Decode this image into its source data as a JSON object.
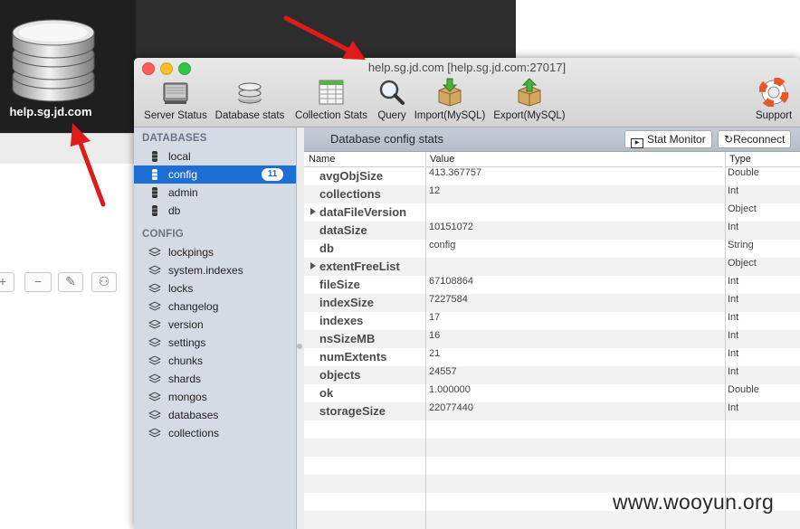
{
  "background_window": {
    "host_label": "help.sg.jd.com",
    "buttons": [
      "+",
      "−",
      "✎",
      "⚇"
    ]
  },
  "window": {
    "title": "help.sg.jd.com [help.sg.jd.com:27017]"
  },
  "toolbar": {
    "server_status": "Server Status",
    "database_stats": "Database stats",
    "collection_stats": "Collection Stats",
    "query": "Query",
    "import": "Import(MySQL)",
    "export": "Export(MySQL)",
    "support": "Support"
  },
  "sidebar": {
    "databases_header": "DATABASES",
    "databases": [
      {
        "label": "local"
      },
      {
        "label": "config",
        "badge": "11",
        "selected": true
      },
      {
        "label": "admin"
      },
      {
        "label": "db"
      }
    ],
    "config_header": "CONFIG",
    "collections": [
      {
        "label": "lockpings"
      },
      {
        "label": "system.indexes"
      },
      {
        "label": "locks"
      },
      {
        "label": "changelog"
      },
      {
        "label": "version"
      },
      {
        "label": "settings"
      },
      {
        "label": "chunks"
      },
      {
        "label": "shards"
      },
      {
        "label": "mongos"
      },
      {
        "label": "databases"
      },
      {
        "label": "collections"
      }
    ]
  },
  "content": {
    "title": "Database config stats",
    "stat_monitor": "Stat Monitor",
    "reconnect": "Reconnect",
    "columns": {
      "name": "Name",
      "value": "Value",
      "type": "Type"
    },
    "rows": [
      {
        "name": "avgObjSize",
        "value": "413.367757",
        "type": "Double"
      },
      {
        "name": "collections",
        "value": "12",
        "type": "Int"
      },
      {
        "name": "dataFileVersion",
        "value": "",
        "type": "Object",
        "expandable": true
      },
      {
        "name": "dataSize",
        "value": "10151072",
        "type": "Int"
      },
      {
        "name": "db",
        "value": "config",
        "type": "String"
      },
      {
        "name": "extentFreeList",
        "value": "",
        "type": "Object",
        "expandable": true
      },
      {
        "name": "fileSize",
        "value": "67108864",
        "type": "Int"
      },
      {
        "name": "indexSize",
        "value": "7227584",
        "type": "Int"
      },
      {
        "name": "indexes",
        "value": "17",
        "type": "Int"
      },
      {
        "name": "nsSizeMB",
        "value": "16",
        "type": "Int"
      },
      {
        "name": "numExtents",
        "value": "21",
        "type": "Int"
      },
      {
        "name": "objects",
        "value": "24557",
        "type": "Int"
      },
      {
        "name": "ok",
        "value": "1.000000",
        "type": "Double"
      },
      {
        "name": "storageSize",
        "value": "22077440",
        "type": "Int"
      }
    ]
  },
  "watermark": "www.wooyun.org",
  "colors": {
    "selection": "#1e6fd4",
    "arrow": "#e01b1b",
    "sidebar_bg": "#d5dbe5"
  }
}
